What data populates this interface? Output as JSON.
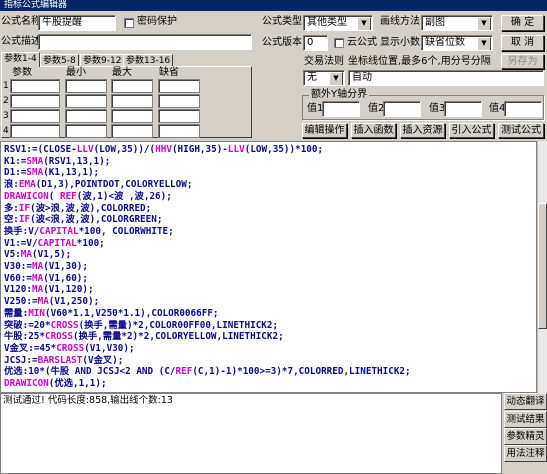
{
  "window": {
    "title": "指标公式编辑器"
  },
  "form": {
    "name_label": "公式名称",
    "name_value": "牛股提醒",
    "password_label": "密码保护",
    "desc_label": "公式描述",
    "desc_value": "",
    "type_label": "公式类型",
    "type_value": "其他类型",
    "draw_label": "画线方法",
    "draw_value": "副图",
    "version_label": "公式版本",
    "version_value": "0",
    "cloud_label": "云公式",
    "decimals_label": "显示小数",
    "decimals_value": "缺省位数",
    "trade_label": "交易法则",
    "coord_label": "坐标线位置,最多6个,用分号分隔",
    "rule_value": "无",
    "auto_value": "自动"
  },
  "buttons": {
    "confirm": "确  定",
    "cancel": "取  消",
    "save_as": "另存为",
    "edit_op": "编辑操作",
    "insert_func": "插入函数",
    "insert_res": "插入资源",
    "import": "引入公式",
    "test": "测试公式"
  },
  "params": {
    "tabs": [
      "参数1-4",
      "参数5-8",
      "参数9-12",
      "参数13-16"
    ],
    "headers": [
      "参数",
      "最小",
      "最大",
      "缺省"
    ],
    "rows": [
      "1",
      "2",
      "3",
      "4"
    ]
  },
  "yaxis": {
    "group_label": "额外Y轴分界",
    "values": [
      "值1",
      "值2",
      "值3",
      "值4"
    ]
  },
  "code_lines": [
    "RSV1:=(CLOSE-LLV(LOW,35))/(HHV(HIGH,35)-LLV(LOW,35))*100;",
    "K1:=SMA(RSV1,13,1);",
    "D1:=SMA(K1,13,1);",
    "浪:EMA(D1,3),POINTDOT,COLORYELLOW;",
    "DRAWICON( REF(波,1)<波 ,波,26);",
    "多:IF(波>浪,波,波),COLORRED;",
    "空:IF(波<浪,波,波),COLORGREEN;",
    "换手:V/CAPITAL*100, COLORWHITE;",
    "V1:=V/CAPITAL*100;",
    "V5:MA(V1,5);",
    "V30:=MA(V1,30);",
    "V60:=MA(V1,60);",
    "V120:MA(V1,120);",
    "V250:=MA(V1,250);",
    "需量:MIN(V60*1.1,V250*1.1),COLOR0066FF;",
    "突破:=20*CROSS(换手,需量)*2,COLOR00FF00,LINETHICK2;",
    "牛股:25*CROSS(换手,需量*2)*2,COLORYELLOW,LINETHICK2;",
    "V金叉:=45*CROSS(V1,V30);",
    "JCSJ:=BARSLAST(V金叉);",
    "优选:10*(牛股 AND JCSJ<2 AND (C/REF(C,1)-1)*100>=3)*7,COLORRED,LINETHICK2;",
    "DRAWICON(优选,1,1);"
  ],
  "status": {
    "message": "测试通过! 代码长度:858,输出线个数:13"
  },
  "side_buttons": [
    "动态翻译",
    "测试结果",
    "参数精灵",
    "用法注释"
  ]
}
